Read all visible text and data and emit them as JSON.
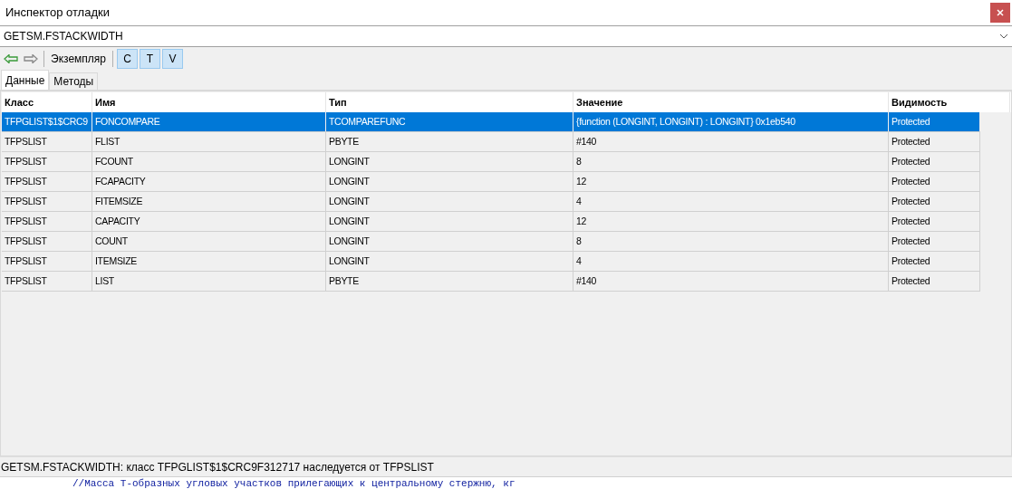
{
  "window": {
    "title": "Инспектор отладки"
  },
  "expression": {
    "value": "GETSM.FSTACKWIDTH"
  },
  "toolbar": {
    "instance_label": "Экземпляр",
    "toggles": [
      {
        "label": "C",
        "selected": true
      },
      {
        "label": "T",
        "selected": true
      },
      {
        "label": "V",
        "selected": true
      }
    ]
  },
  "tabs": [
    {
      "label": "Данные",
      "selected": true
    },
    {
      "label": "Методы",
      "selected": false
    }
  ],
  "table": {
    "columns": [
      "Класс",
      "Имя",
      "Тип",
      "Значение",
      "Видимость"
    ],
    "rows": [
      {
        "selected": true,
        "cells": [
          "TFPGLIST$1$CRC9",
          "FONCOMPARE",
          "TCOMPAREFUNC",
          "{function  (LONGINT, LONGINT) : LONGINT} 0x1eb540",
          "Protected"
        ]
      },
      {
        "selected": false,
        "cells": [
          "TFPSLIST",
          "FLIST",
          "PBYTE",
          "#140",
          "Protected"
        ]
      },
      {
        "selected": false,
        "cells": [
          "TFPSLIST",
          "FCOUNT",
          "LONGINT",
          "8",
          "Protected"
        ]
      },
      {
        "selected": false,
        "cells": [
          "TFPSLIST",
          "FCAPACITY",
          "LONGINT",
          "12",
          "Protected"
        ]
      },
      {
        "selected": false,
        "cells": [
          "TFPSLIST",
          "FITEMSIZE",
          "LONGINT",
          "4",
          "Protected"
        ]
      },
      {
        "selected": false,
        "cells": [
          "TFPSLIST",
          "CAPACITY",
          "LONGINT",
          "12",
          "Protected"
        ]
      },
      {
        "selected": false,
        "cells": [
          "TFPSLIST",
          "COUNT",
          "LONGINT",
          "8",
          "Protected"
        ]
      },
      {
        "selected": false,
        "cells": [
          "TFPSLIST",
          "ITEMSIZE",
          "LONGINT",
          "4",
          "Protected"
        ]
      },
      {
        "selected": false,
        "cells": [
          "TFPSLIST",
          "LIST",
          "PBYTE",
          "#140",
          "Protected"
        ]
      }
    ]
  },
  "status_bar": "GETSM.FSTACKWIDTH: класс TFPGLIST$1$CRC9F312717 наследуется от TFPSLIST",
  "editor_behind": {
    "code_line": "//Масса Т-образных угловых участков прилегающих к центральному стержню, кг"
  }
}
